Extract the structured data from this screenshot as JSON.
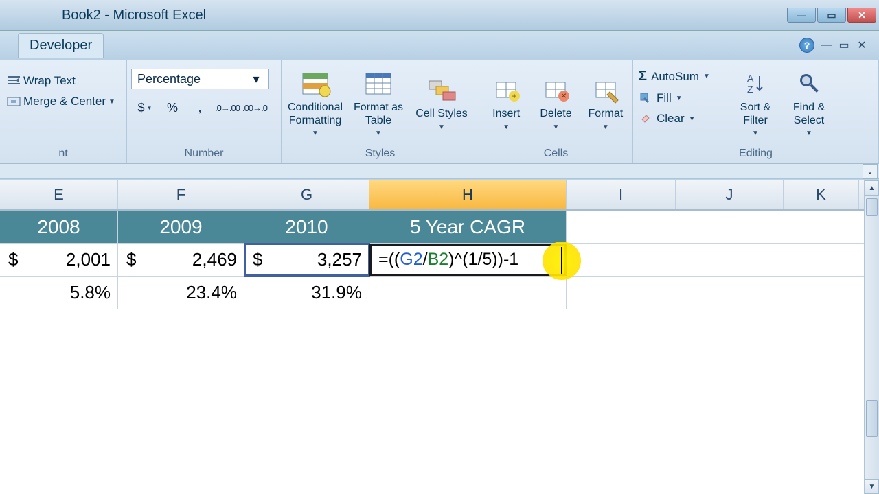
{
  "window": {
    "title": "Book2 - Microsoft Excel"
  },
  "tabs": {
    "developer": "Developer"
  },
  "ribbon": {
    "alignment": {
      "wrap": "Wrap Text",
      "merge": "Merge & Center",
      "label": "nt"
    },
    "number": {
      "format": "Percentage",
      "dollar": "$",
      "percent": "%",
      "comma": ",",
      "label": "Number"
    },
    "styles": {
      "cond": "Conditional Formatting",
      "table": "Format as Table",
      "cell": "Cell Styles",
      "label": "Styles"
    },
    "cells": {
      "insert": "Insert",
      "delete": "Delete",
      "format": "Format",
      "label": "Cells"
    },
    "editing": {
      "autosum": "AutoSum",
      "fill": "Fill",
      "clear": "Clear",
      "sort": "Sort & Filter",
      "find": "Find & Select",
      "label": "Editing"
    }
  },
  "columns": {
    "E": "E",
    "F": "F",
    "G": "G",
    "H": "H",
    "I": "I",
    "J": "J",
    "K": "K"
  },
  "headers": {
    "E": "2008",
    "F": "2009",
    "G": "2010",
    "H": "5 Year CAGR"
  },
  "row2": {
    "E": {
      "cur": "$",
      "val": "2,001"
    },
    "F": {
      "cur": "$",
      "val": "2,469"
    },
    "G": {
      "cur": "$",
      "val": "3,257"
    },
    "H_formula_pre": "=((",
    "H_formula_ref1": "G2",
    "H_formula_mid1": "/",
    "H_formula_ref2": "B2",
    "H_formula_mid2": ")^(1/5))-1"
  },
  "row3": {
    "E": "5.8%",
    "F": "23.4%",
    "G": "31.9%"
  }
}
